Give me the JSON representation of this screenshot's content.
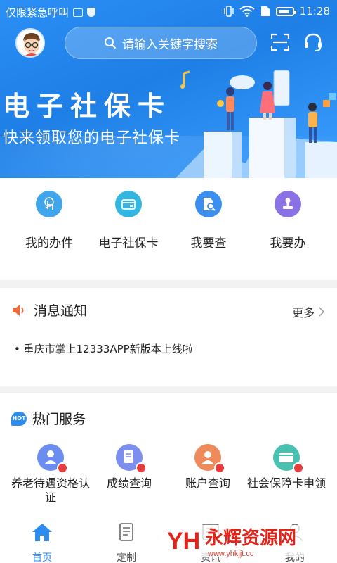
{
  "status_bar": {
    "carrier": "仅限紧急呼叫",
    "time": "11:28",
    "icons": [
      "image-icon",
      "shield-icon",
      "vibrate-icon",
      "wifi-icon",
      "sim-icon",
      "battery-icon"
    ]
  },
  "header": {
    "search_placeholder": "请输入关键字搜索",
    "icons": [
      "avatar",
      "search-icon",
      "scan-icon",
      "headset-icon"
    ]
  },
  "banner": {
    "title": "电子社保卡",
    "subtitle": "快来领取您的电子社保卡"
  },
  "quick_actions": [
    {
      "label": "我的办件",
      "icon": "hand-touch-icon",
      "color": "#3fa6ec"
    },
    {
      "label": "电子社保卡",
      "icon": "card-icon",
      "color": "#34b6e3"
    },
    {
      "label": "我要查",
      "icon": "doc-search-icon",
      "color": "#3a8ff0"
    },
    {
      "label": "我要办",
      "icon": "stamp-icon",
      "color": "#8a72e6"
    }
  ],
  "notice": {
    "title": "消息通知",
    "more_label": "更多",
    "items": [
      "重庆市掌上12333APP新版本上线啦"
    ]
  },
  "hot_services": {
    "badge": "HOT",
    "title": "热门服务",
    "items": [
      {
        "label": "养老待遇资格认证",
        "icon": "elder-cert-icon",
        "color": "#6b8df0"
      },
      {
        "label": "成绩查询",
        "icon": "score-query-icon",
        "color": "#7c8ff0"
      },
      {
        "label": "账户查询",
        "icon": "account-query-icon",
        "color": "#ef8a5a"
      },
      {
        "label": "社会保障卡申领",
        "icon": "card-apply-icon",
        "color": "#49c1b0"
      }
    ]
  },
  "tabbar": {
    "items": [
      {
        "label": "首页",
        "icon": "home-icon",
        "active": true
      },
      {
        "label": "定制",
        "icon": "custom-icon",
        "active": false
      },
      {
        "label": "资讯",
        "icon": "news-icon",
        "active": false
      },
      {
        "label": "我的",
        "icon": "mine-icon",
        "active": false
      }
    ]
  },
  "watermark": {
    "text": "永辉资源网",
    "sub": "www.yhkjjt.cc",
    "logo": "YH"
  },
  "colors": {
    "primary": "#2d8cf0",
    "banner_top": "#2b8ff5",
    "hot_badge": "#2d8cf0",
    "watermark_red": "#e2231a"
  }
}
